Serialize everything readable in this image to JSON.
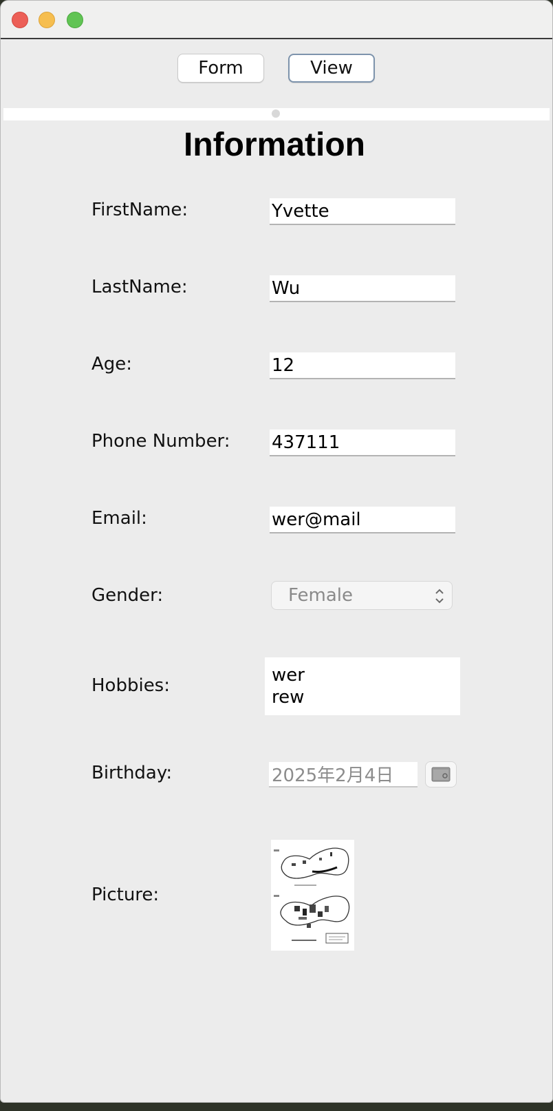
{
  "toolbar": {
    "form_label": "Form",
    "view_label": "View"
  },
  "page": {
    "title": "Information"
  },
  "fields": {
    "first_name": {
      "label": "FirstName:",
      "value": "Yvette"
    },
    "last_name": {
      "label": "LastName:",
      "value": "Wu"
    },
    "age": {
      "label": "Age:",
      "value": "12"
    },
    "phone": {
      "label": "Phone Number:",
      "value": "437111"
    },
    "email": {
      "label": "Email:",
      "value": "wer@mail"
    },
    "gender": {
      "label": "Gender:",
      "value": "Female"
    },
    "hobbies": {
      "label": "Hobbies:",
      "lines": [
        "wer",
        "rew"
      ]
    },
    "birthday": {
      "label": "Birthday:",
      "value": "2025年2月4日"
    },
    "picture": {
      "label": "Picture:"
    }
  },
  "icons": {
    "calendar": "calendar-icon",
    "select_chevron": "chevron-updown-icon"
  },
  "colors": {
    "view_button_border": "#7d93ac",
    "window_bg": "#ececec"
  }
}
